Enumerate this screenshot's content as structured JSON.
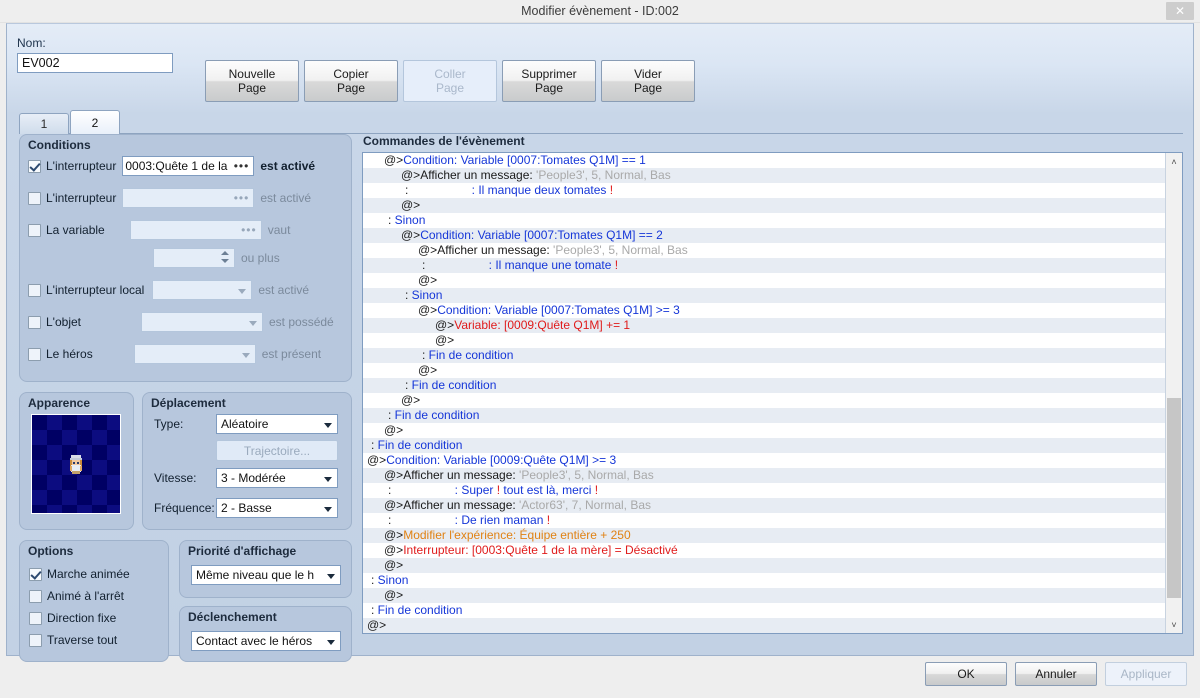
{
  "window": {
    "title": "Modifier évènement - ID:002",
    "close_label": "✕"
  },
  "name_field": {
    "label": "Nom:",
    "value": "EV002"
  },
  "page_buttons": [
    {
      "label": "Nouvelle\nPage",
      "enabled": true
    },
    {
      "label": "Copier\nPage",
      "enabled": true
    },
    {
      "label": "Coller\nPage",
      "enabled": false
    },
    {
      "label": "Supprimer\nPage",
      "enabled": true
    },
    {
      "label": "Vider\nPage",
      "enabled": true
    }
  ],
  "tabs": [
    {
      "label": "1",
      "active": false
    },
    {
      "label": "2",
      "active": true
    }
  ],
  "conditions": {
    "title": "Conditions",
    "rows": [
      {
        "label": "L'interrupteur",
        "checked": true,
        "value": "0003:Quête 1 de la ",
        "suffix": "est activé"
      },
      {
        "label": "L'interrupteur",
        "checked": false,
        "value": "",
        "suffix": "est activé"
      },
      {
        "label": "La variable",
        "checked": false,
        "value": "",
        "suffix": "vaut"
      },
      {
        "label": "",
        "checked": false,
        "value": "",
        "suffix": "ou plus"
      },
      {
        "label": "L'interrupteur local",
        "checked": false,
        "value": "",
        "suffix": "est activé"
      },
      {
        "label": "L'objet",
        "checked": false,
        "value": "",
        "suffix": "est possédé"
      },
      {
        "label": "Le héros",
        "checked": false,
        "value": "",
        "suffix": "est présent"
      }
    ]
  },
  "appearance": {
    "title": "Apparence"
  },
  "movement": {
    "title": "Déplacement",
    "type_label": "Type:",
    "type_value": "Aléatoire",
    "route_button": "Trajectoire...",
    "speed_label": "Vitesse:",
    "speed_value": "3 - Modérée",
    "freq_label": "Fréquence:",
    "freq_value": "2 - Basse"
  },
  "options": {
    "title": "Options",
    "items": [
      {
        "label": "Marche animée",
        "checked": true
      },
      {
        "label": "Animé à l'arrêt",
        "checked": false
      },
      {
        "label": "Direction fixe",
        "checked": false
      },
      {
        "label": "Traverse tout",
        "checked": false
      }
    ]
  },
  "priority": {
    "title": "Priorité d'affichage",
    "value": "Même niveau que le h"
  },
  "trigger": {
    "title": "Déclenchement",
    "value": "Contact avec le héros"
  },
  "commands": {
    "title": "Commandes de l'évènement",
    "scrollbar": {
      "up_icon": "˄",
      "down_icon": "˅"
    },
    "lines": [
      {
        "indent": 1,
        "marker": "@>",
        "segments": [
          {
            "text": "Condition: Variable [0007:Tomates Q1M] == 1",
            "color": "blue"
          }
        ]
      },
      {
        "indent": 2,
        "marker": "@>",
        "segments": [
          {
            "text": "Afficher un message: ",
            "color": "dark"
          },
          {
            "text": "'People3', 5, Normal, Bas",
            "color": "grey"
          }
        ]
      },
      {
        "indent": 2,
        "marker": ":",
        "segments": [
          {
            "text": "                  : Il manque deux tomates ",
            "color": "blue"
          },
          {
            "text": "!",
            "color": "red"
          }
        ]
      },
      {
        "indent": 2,
        "marker": "@>",
        "segments": []
      },
      {
        "indent": 1,
        "marker": ":",
        "segments": [
          {
            "text": "Sinon",
            "color": "blue"
          }
        ]
      },
      {
        "indent": 2,
        "marker": "@>",
        "segments": [
          {
            "text": "Condition: Variable [0007:Tomates Q1M] == 2",
            "color": "blue"
          }
        ]
      },
      {
        "indent": 3,
        "marker": "@>",
        "segments": [
          {
            "text": "Afficher un message: ",
            "color": "dark"
          },
          {
            "text": "'People3', 5, Normal, Bas",
            "color": "grey"
          }
        ]
      },
      {
        "indent": 3,
        "marker": ":",
        "segments": [
          {
            "text": "                  : Il manque une tomate ",
            "color": "blue"
          },
          {
            "text": "!",
            "color": "red"
          }
        ]
      },
      {
        "indent": 3,
        "marker": "@>",
        "segments": []
      },
      {
        "indent": 2,
        "marker": ":",
        "segments": [
          {
            "text": "Sinon",
            "color": "blue"
          }
        ]
      },
      {
        "indent": 3,
        "marker": "@>",
        "segments": [
          {
            "text": "Condition: Variable [0007:Tomates Q1M] >= 3",
            "color": "blue"
          }
        ]
      },
      {
        "indent": 4,
        "marker": "@>",
        "segments": [
          {
            "text": "Variable: [0009:Quête Q1M] += 1",
            "color": "red"
          }
        ]
      },
      {
        "indent": 4,
        "marker": "@>",
        "segments": []
      },
      {
        "indent": 3,
        "marker": ":",
        "segments": [
          {
            "text": "Fin de condition",
            "color": "blue"
          }
        ]
      },
      {
        "indent": 3,
        "marker": "@>",
        "segments": []
      },
      {
        "indent": 2,
        "marker": ":",
        "segments": [
          {
            "text": "Fin de condition",
            "color": "blue"
          }
        ]
      },
      {
        "indent": 2,
        "marker": "@>",
        "segments": []
      },
      {
        "indent": 1,
        "marker": ":",
        "segments": [
          {
            "text": "Fin de condition",
            "color": "blue"
          }
        ]
      },
      {
        "indent": 1,
        "marker": "@>",
        "segments": []
      },
      {
        "indent": 0,
        "marker": ":",
        "segments": [
          {
            "text": "Fin de condition",
            "color": "blue"
          }
        ]
      },
      {
        "indent": 0,
        "marker": "@>",
        "segments": [
          {
            "text": "Condition: Variable [0009:Quête Q1M] >= 3",
            "color": "blue"
          }
        ]
      },
      {
        "indent": 1,
        "marker": "@>",
        "segments": [
          {
            "text": "Afficher un message: ",
            "color": "dark"
          },
          {
            "text": "'People3', 5, Normal, Bas",
            "color": "grey"
          }
        ]
      },
      {
        "indent": 1,
        "marker": ":",
        "segments": [
          {
            "text": "                  : Super ",
            "color": "blue"
          },
          {
            "text": "!",
            "color": "red"
          },
          {
            "text": " tout est là, merci ",
            "color": "blue"
          },
          {
            "text": "!",
            "color": "red"
          }
        ]
      },
      {
        "indent": 1,
        "marker": "@>",
        "segments": [
          {
            "text": "Afficher un message: ",
            "color": "dark"
          },
          {
            "text": "'Actor63', 7, Normal, Bas",
            "color": "grey"
          }
        ]
      },
      {
        "indent": 1,
        "marker": ":",
        "segments": [
          {
            "text": "                  : De rien maman ",
            "color": "blue"
          },
          {
            "text": "!",
            "color": "red"
          }
        ]
      },
      {
        "indent": 1,
        "marker": "@>",
        "segments": [
          {
            "text": "Modifier l'expérience: Équipe entière + 250",
            "color": "orange"
          }
        ]
      },
      {
        "indent": 1,
        "marker": "@>",
        "segments": [
          {
            "text": "Interrupteur: [0003:Quête 1 de la mère] = Désactivé",
            "color": "red"
          }
        ]
      },
      {
        "indent": 1,
        "marker": "@>",
        "segments": []
      },
      {
        "indent": 0,
        "marker": ":",
        "segments": [
          {
            "text": "Sinon",
            "color": "blue"
          }
        ]
      },
      {
        "indent": 1,
        "marker": "@>",
        "segments": []
      },
      {
        "indent": 0,
        "marker": ":",
        "segments": [
          {
            "text": "Fin de condition",
            "color": "blue"
          }
        ]
      },
      {
        "indent": 0,
        "marker": "@>",
        "segments": []
      }
    ]
  },
  "footer_buttons": [
    {
      "label": "OK",
      "enabled": true
    },
    {
      "label": "Annuler",
      "enabled": true
    },
    {
      "label": "Appliquer",
      "enabled": false
    }
  ]
}
